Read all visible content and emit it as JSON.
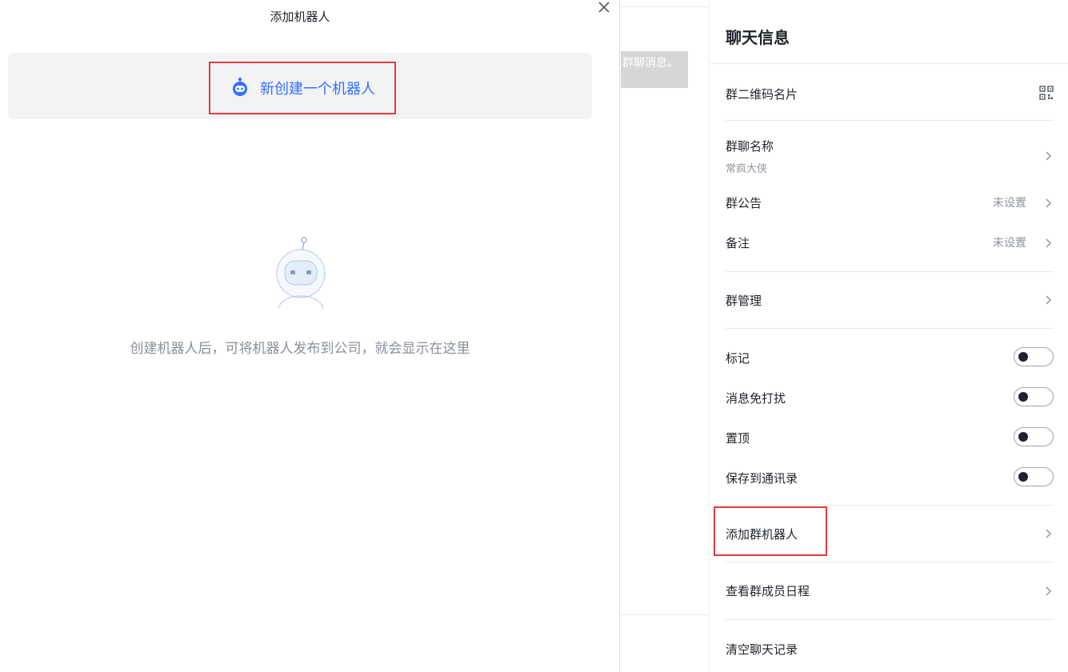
{
  "dialog": {
    "title": "添加机器人",
    "create_label": "新创建一个机器人",
    "empty_text": "创建机器人后，可将机器人发布到公司，就会显示在这里"
  },
  "chat": {
    "bubble_text": "群聊消息。"
  },
  "panel": {
    "title": "聊天信息",
    "qr_label": "群二维码名片",
    "group_name_label": "群聊名称",
    "group_name_value": "常疯大侠",
    "announcement_label": "群公告",
    "announcement_value": "未设置",
    "remark_label": "备注",
    "remark_value": "未设置",
    "manage_label": "群管理",
    "toggles": [
      {
        "label": "标记",
        "on": false
      },
      {
        "label": "消息免打扰",
        "on": false
      },
      {
        "label": "置顶",
        "on": false
      },
      {
        "label": "保存到通讯录",
        "on": false
      }
    ],
    "add_robot_label": "添加群机器人",
    "schedule_label": "查看群成员日程",
    "clear_label": "清空聊天记录"
  },
  "colors": {
    "accent": "#3370ff",
    "highlight": "#e5393c",
    "muted": "#8f959e"
  },
  "icons": [
    "close-icon",
    "robot-icon",
    "robot-illustration",
    "qr-code-icon",
    "chevron-right-icon"
  ]
}
